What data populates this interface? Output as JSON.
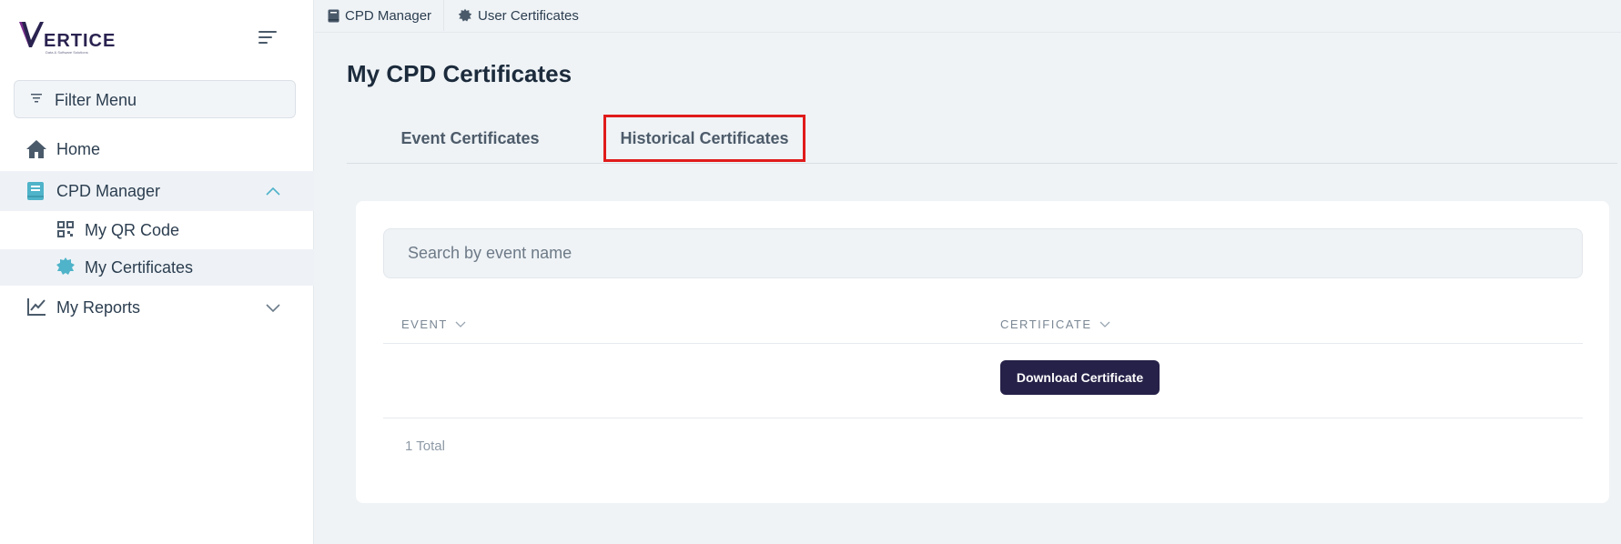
{
  "sidebar": {
    "logo_text": "ERTICE",
    "logo_tagline": "Data & Software Solutions",
    "filter_label": "Filter Menu",
    "items": [
      {
        "label": "Home",
        "icon": "home-icon"
      },
      {
        "label": "CPD Manager",
        "icon": "book-icon",
        "expanded": true
      },
      {
        "label": "My QR Code",
        "icon": "qr-code-icon"
      },
      {
        "label": "My Certificates",
        "icon": "certificate-badge-icon",
        "active": true
      },
      {
        "label": "My Reports",
        "icon": "line-chart-icon",
        "expanded": false
      }
    ]
  },
  "breadcrumb": [
    {
      "label": "CPD Manager",
      "icon": "book-icon"
    },
    {
      "label": "User Certificates",
      "icon": "certificate-badge-icon"
    }
  ],
  "page": {
    "title": "My CPD Certificates",
    "tabs": [
      {
        "label": "Event Certificates"
      },
      {
        "label": "Historical Certificates",
        "highlighted": true
      }
    ],
    "search": {
      "placeholder": "Search by event name",
      "value": ""
    },
    "table": {
      "columns": [
        "EVENT",
        "CERTIFICATE"
      ],
      "rows": [
        {
          "event": "",
          "certificate_button": "Download Certificate"
        }
      ],
      "total": "1 Total"
    }
  },
  "colors": {
    "accent_dark": "#262148",
    "sidebar_active_icon": "#4fb3c9",
    "highlight_border": "#e01b1b"
  }
}
